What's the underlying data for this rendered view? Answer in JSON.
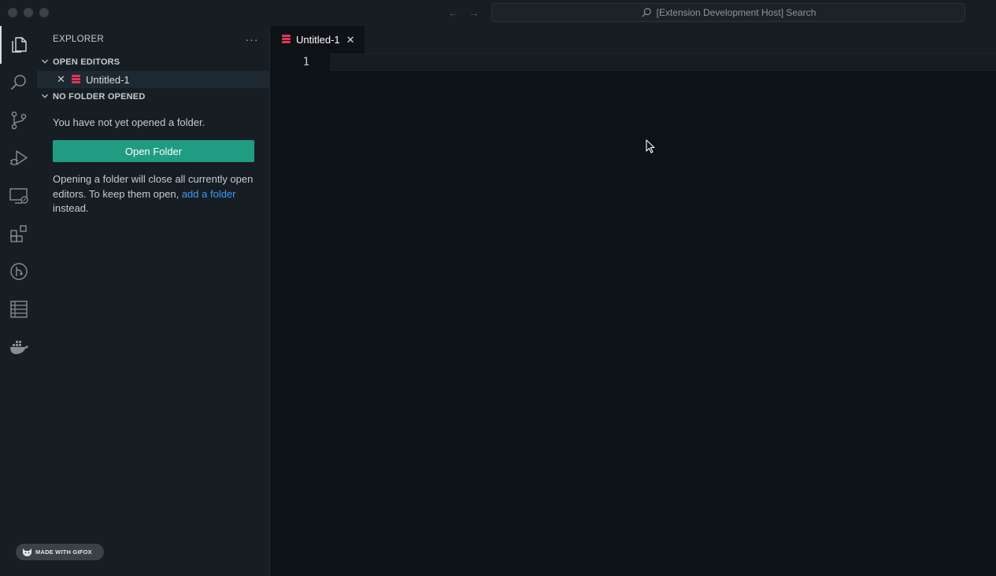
{
  "window": {
    "search_placeholder": "[Extension Development Host] Search"
  },
  "activity_bar": {
    "items": [
      {
        "name": "explorer",
        "active": true
      },
      {
        "name": "search"
      },
      {
        "name": "source-control"
      },
      {
        "name": "run-and-debug"
      },
      {
        "name": "remote-explorer"
      },
      {
        "name": "extensions"
      },
      {
        "name": "git-graph"
      },
      {
        "name": "database"
      },
      {
        "name": "docker"
      }
    ],
    "badge_text": "MADE WITH GIFOX"
  },
  "sidebar": {
    "title": "EXPLORER",
    "more_label": "···",
    "open_editors": {
      "header": "OPEN EDITORS",
      "items": [
        {
          "label": "Untitled-1",
          "icon": "database-icon"
        }
      ]
    },
    "no_folder": {
      "header": "NO FOLDER OPENED",
      "message": "You have not yet opened a folder.",
      "button_label": "Open Folder",
      "info_before_link": "Opening a folder will close all currently open editors. To keep them open,",
      "link_text": "add a folder",
      "info_after_link": "instead."
    }
  },
  "editor": {
    "tab_label": "Untitled-1",
    "line_number": "1"
  },
  "colors": {
    "accent_button": "#1f9c82",
    "link": "#3d9cf0",
    "file_icon": "#e0345a"
  }
}
